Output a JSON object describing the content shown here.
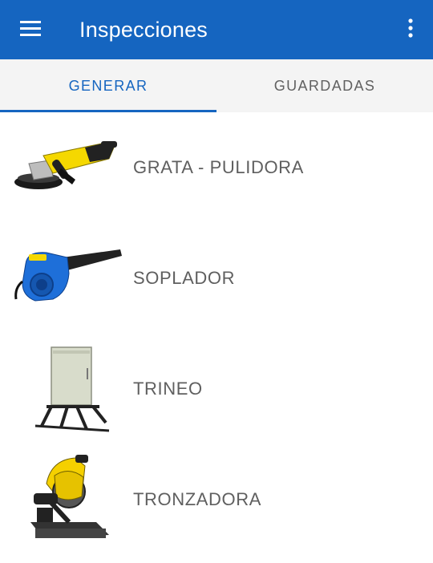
{
  "appbar": {
    "title": "Inspecciones",
    "menu_icon": "hamburger-menu-icon",
    "overflow_icon": "more-vert-icon",
    "color": "#1565c0"
  },
  "tabs": [
    {
      "label": "GENERAR",
      "active": true
    },
    {
      "label": "GUARDADAS",
      "active": false
    }
  ],
  "items": [
    {
      "label": "GRATA - PULIDORA",
      "icon": "angle-grinder-image"
    },
    {
      "label": "SOPLADOR",
      "icon": "blower-image"
    },
    {
      "label": "TRINEO",
      "icon": "electrical-cabinet-sled-image"
    },
    {
      "label": "TRONZADORA",
      "icon": "chop-saw-image"
    }
  ]
}
